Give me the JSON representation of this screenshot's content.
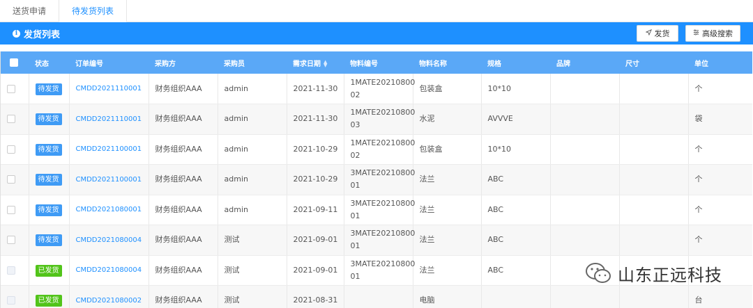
{
  "tabs": [
    {
      "label": "送货申请",
      "active": false
    },
    {
      "label": "待发货列表",
      "active": true
    }
  ],
  "bar": {
    "title": "发货列表",
    "info_icon": "info-icon"
  },
  "toolbar": {
    "ship_label": "发货",
    "ship_icon": "send-icon",
    "advanced_label": "高级搜索",
    "advanced_icon": "filter-icon"
  },
  "colors": {
    "primary": "#1e90ff",
    "header": "#5aa8f7",
    "pending": "#3f9bf5",
    "shipped": "#52c41a"
  },
  "table": {
    "columns": [
      "状态",
      "订单编号",
      "采购方",
      "采购员",
      "需求日期",
      "物料编号",
      "物料名称",
      "规格",
      "品牌",
      "尺寸",
      "单位"
    ],
    "rows": [
      {
        "status": "待发货",
        "order": "CMDD2021110001",
        "buyer": "财务组织AAA",
        "purchaser": "admin",
        "date": "2021-11-30",
        "material_no": "1MATE20210800\n02",
        "material": "包装盒",
        "spec": "10*10",
        "brand": "",
        "size": "",
        "unit": "个"
      },
      {
        "status": "待发货",
        "order": "CMDD2021110001",
        "buyer": "财务组织AAA",
        "purchaser": "admin",
        "date": "2021-11-30",
        "material_no": "1MATE20210800\n03",
        "material": "水泥",
        "spec": "AVVVE",
        "brand": "",
        "size": "",
        "unit": "袋"
      },
      {
        "status": "待发货",
        "order": "CMDD2021100001",
        "buyer": "财务组织AAA",
        "purchaser": "admin",
        "date": "2021-10-29",
        "material_no": "1MATE20210800\n02",
        "material": "包装盒",
        "spec": "10*10",
        "brand": "",
        "size": "",
        "unit": "个"
      },
      {
        "status": "待发货",
        "order": "CMDD2021100001",
        "buyer": "财务组织AAA",
        "purchaser": "admin",
        "date": "2021-10-29",
        "material_no": "3MATE20210800\n01",
        "material": "法兰",
        "spec": "ABC",
        "brand": "",
        "size": "",
        "unit": "个"
      },
      {
        "status": "待发货",
        "order": "CMDD2021080001",
        "buyer": "财务组织AAA",
        "purchaser": "admin",
        "date": "2021-09-11",
        "material_no": "3MATE20210800\n01",
        "material": "法兰",
        "spec": "ABC",
        "brand": "",
        "size": "",
        "unit": "个"
      },
      {
        "status": "待发货",
        "order": "CMDD2021080004",
        "buyer": "财务组织AAA",
        "purchaser": "测试",
        "date": "2021-09-01",
        "material_no": "3MATE20210800\n01",
        "material": "法兰",
        "spec": "ABC",
        "brand": "",
        "size": "",
        "unit": "个"
      },
      {
        "status": "已发货",
        "order": "CMDD2021080004",
        "buyer": "财务组织AAA",
        "purchaser": "测试",
        "date": "2021-09-01",
        "material_no": "3MATE20210800\n01",
        "material": "法兰",
        "spec": "ABC",
        "brand": "",
        "size": "",
        "unit": ""
      },
      {
        "status": "已发货",
        "order": "CMDD2021080002",
        "buyer": "财务组织AAA",
        "purchaser": "测试",
        "date": "2021-08-31",
        "material_no": "",
        "material": "电脑",
        "spec": "",
        "brand": "",
        "size": "",
        "unit": "台"
      }
    ]
  },
  "watermark": {
    "text": "山东正远科技",
    "icon": "wechat-icon"
  }
}
